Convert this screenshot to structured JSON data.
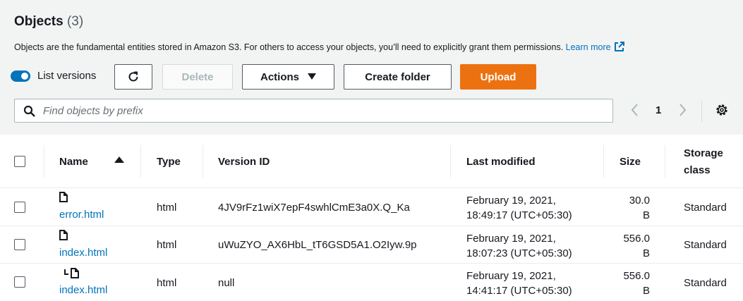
{
  "header": {
    "title": "Objects",
    "count": "(3)",
    "description": "Objects are the fundamental entities stored in Amazon S3. For others to access your objects, you’ll need to explicitly grant them permissions.",
    "learn_more": "Learn more"
  },
  "toolbar": {
    "list_versions_label": "List versions",
    "list_versions_on": true,
    "delete_label": "Delete",
    "actions_label": "Actions",
    "create_folder_label": "Create folder",
    "upload_label": "Upload"
  },
  "search": {
    "placeholder": "Find objects by prefix",
    "value": ""
  },
  "pagination": {
    "current_page": "1"
  },
  "colors": {
    "accent": "#0073bb",
    "upload": "#ec7211",
    "panel": "#f2f3f3"
  },
  "table": {
    "headers": {
      "name": "Name",
      "type": "Type",
      "version_id": "Version ID",
      "last_modified": "Last modified",
      "size": "Size",
      "storage_class_1": "Storage",
      "storage_class_2": "class"
    },
    "rows": [
      {
        "icon": "file-icon",
        "name": "error.html",
        "type": "html",
        "version_id": "4JV9rFz1wiX7epF4swhlCmE3a0X.Q_Ka",
        "date1": "February 19, 2021,",
        "date2": "18:49:17 (UTC+05:30)",
        "size1": "30.0",
        "size2": "B",
        "storage_class": "Standard"
      },
      {
        "icon": "file-icon",
        "name": "index.html",
        "type": "html",
        "version_id": "uWuZYO_AX6HbL_tT6GSD5A1.O2Iyw.9p",
        "date1": "February 19, 2021,",
        "date2": "18:07:23 (UTC+05:30)",
        "size1": "556.0",
        "size2": "B",
        "storage_class": "Standard"
      },
      {
        "icon": "version-file-icon",
        "name": "index.html",
        "type": "html",
        "version_id": "null",
        "date1": "February 19, 2021,",
        "date2": "14:41:17 (UTC+05:30)",
        "size1": "556.0",
        "size2": "B",
        "storage_class": "Standard"
      }
    ]
  }
}
